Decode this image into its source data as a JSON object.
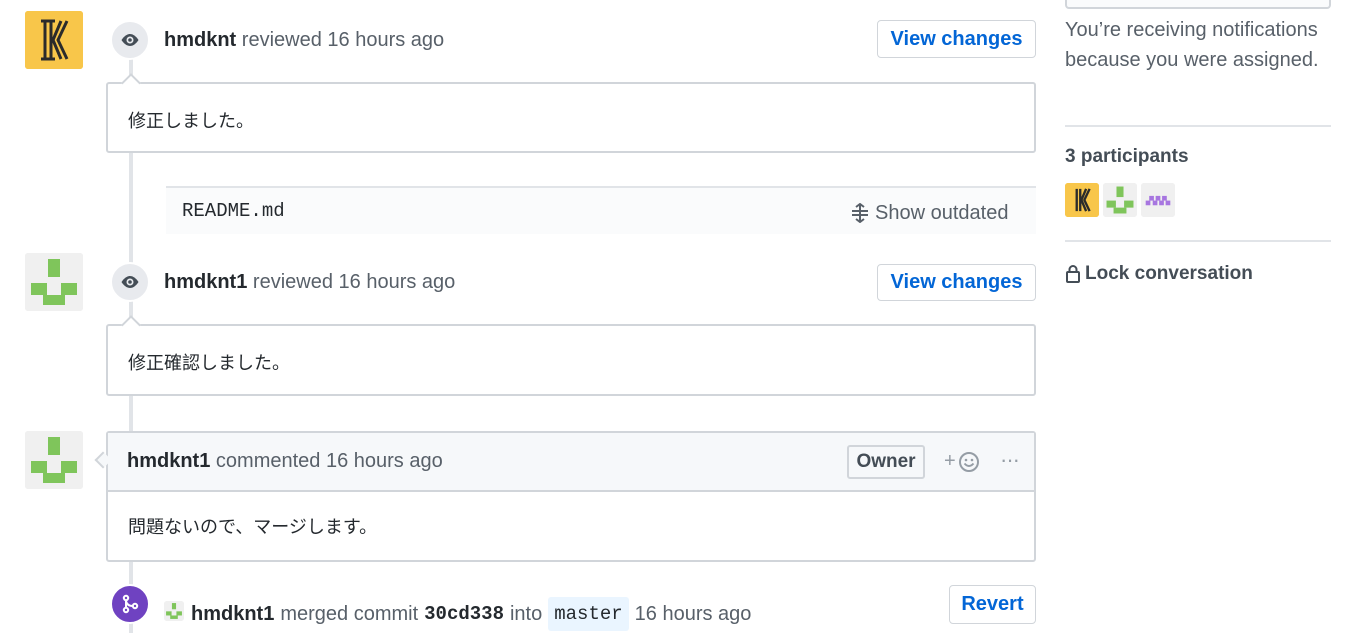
{
  "timeline": {
    "event1": {
      "author": "hmdknt",
      "action": "reviewed",
      "time": "16 hours ago",
      "button": "View changes",
      "body": "修正しました。",
      "file": "README.md",
      "show_outdated": "Show outdated"
    },
    "event2": {
      "author": "hmdknt1",
      "action": "reviewed",
      "time": "16 hours ago",
      "button": "View changes",
      "body": "修正確認しました。"
    },
    "comment": {
      "author": "hmdknt1",
      "action": "commented",
      "time": "16 hours ago",
      "role": "Owner",
      "reaction": "+",
      "more": "···",
      "body": "問題ないので、マージします。"
    },
    "merge": {
      "author": "hmdknt1",
      "action": "merged commit",
      "commit": "30cd338",
      "into": "into",
      "branch": "master",
      "time": "16 hours ago",
      "button": "Revert"
    }
  },
  "sidebar": {
    "notification_text": "You’re receiving notifications because you were assigned.",
    "participants_label": "3 participants",
    "lock_label": "Lock conversation"
  },
  "colors": {
    "link": "#0366d6",
    "merge_badge": "#6f42c1",
    "avatar_yellow": "#f9c74f",
    "avatar_green": "#7fc55b",
    "avatar_purple": "#a776e0"
  }
}
